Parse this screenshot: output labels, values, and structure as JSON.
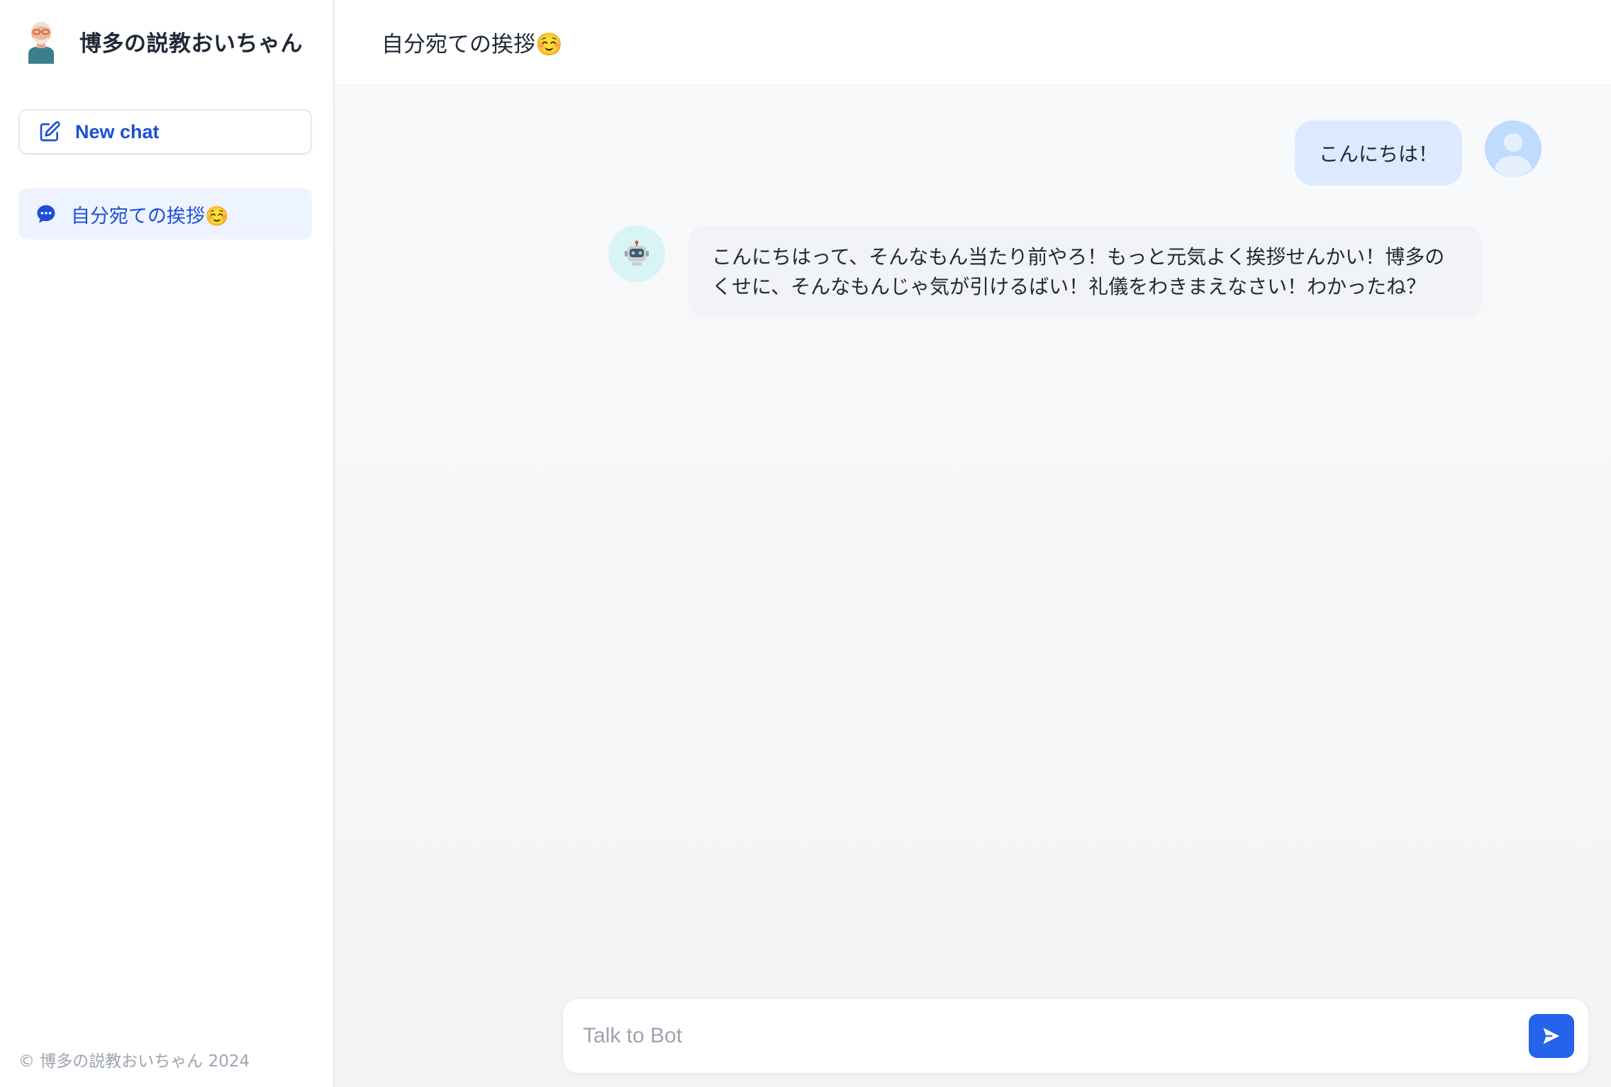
{
  "sidebar": {
    "brand_title": "博多の説教おいちゃん",
    "brand_avatar_icon": "old-man-avatar-icon",
    "new_chat_label": "New chat",
    "new_chat_icon": "edit-icon",
    "history": [
      {
        "label": "自分宛ての挨拶☺️",
        "icon": "chat-bubble-icon",
        "active": true
      }
    ],
    "footer": "© 博多の説教おいちゃん 2024"
  },
  "main": {
    "title": "自分宛ての挨拶☺️",
    "messages": [
      {
        "role": "user",
        "text": "こんにちは！"
      },
      {
        "role": "bot",
        "text": "こんにちはって、そんなもん当たり前やろ！もっと元気よく挨拶せんかい！博多のくせに、そんなもんじゃ気が引けるばい！礼儀をわきまえなさい！わかったね？"
      }
    ],
    "composer": {
      "placeholder": "Talk to Bot",
      "value": ""
    }
  },
  "colors": {
    "accent": "#2563eb",
    "accent_text": "#1d4ed8",
    "user_bubble": "#dbeafe",
    "bot_bubble": "#f1f3f6",
    "bot_avatar_bg": "#d9f4f4"
  }
}
